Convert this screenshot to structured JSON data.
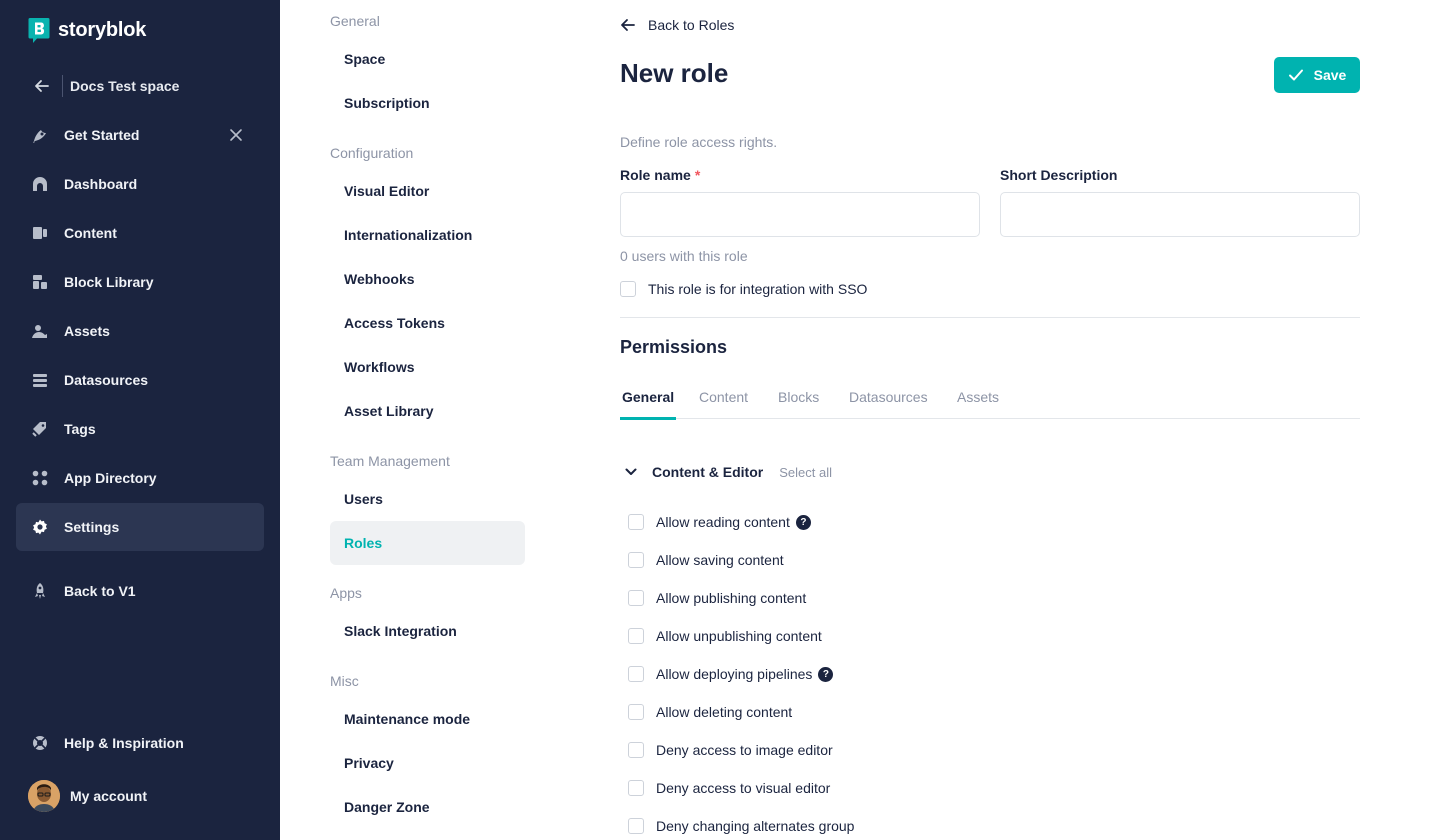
{
  "app": {
    "name": "storyblok"
  },
  "space": {
    "name": "Docs Test space"
  },
  "nav": {
    "items": [
      {
        "label": "Get Started",
        "icon": "rocket-icon"
      },
      {
        "label": "Dashboard",
        "icon": "dashboard-icon"
      },
      {
        "label": "Content",
        "icon": "content-icon"
      },
      {
        "label": "Block Library",
        "icon": "blocks-icon"
      },
      {
        "label": "Assets",
        "icon": "assets-icon"
      },
      {
        "label": "Datasources",
        "icon": "datasources-icon"
      },
      {
        "label": "Tags",
        "icon": "tag-icon"
      },
      {
        "label": "App Directory",
        "icon": "apps-icon"
      },
      {
        "label": "Settings",
        "icon": "gear-icon"
      }
    ],
    "back_v1": "Back to V1",
    "help": "Help & Inspiration",
    "account": "My account"
  },
  "settings_menu": {
    "groups": [
      {
        "title": "General",
        "items": [
          "Space",
          "Subscription"
        ]
      },
      {
        "title": "Configuration",
        "items": [
          "Visual Editor",
          "Internationalization",
          "Webhooks",
          "Access Tokens",
          "Workflows",
          "Asset Library"
        ]
      },
      {
        "title": "Team Management",
        "items": [
          "Users",
          "Roles"
        ]
      },
      {
        "title": "Apps",
        "items": [
          "Slack Integration"
        ]
      },
      {
        "title": "Misc",
        "items": [
          "Maintenance mode",
          "Privacy",
          "Danger Zone"
        ]
      }
    ],
    "active_item": "Roles"
  },
  "main": {
    "back_label": "Back to Roles",
    "title": "New role",
    "save_label": "Save",
    "helper": "Define role access rights.",
    "role_name_label": "Role name",
    "required_mark": "*",
    "short_desc_label": "Short Description",
    "role_name_value": "",
    "short_desc_value": "",
    "users_count": "0 users with this role",
    "sso_label": "This role is for integration with SSO",
    "permissions_title": "Permissions",
    "tabs": [
      "General",
      "Content",
      "Blocks",
      "Datasources",
      "Assets"
    ],
    "active_tab": "General",
    "section_title": "Content & Editor",
    "select_all": "Select all",
    "permissions": [
      {
        "label": "Allow reading content",
        "help": true
      },
      {
        "label": "Allow saving content",
        "help": false
      },
      {
        "label": "Allow publishing content",
        "help": false
      },
      {
        "label": "Allow unpublishing content",
        "help": false
      },
      {
        "label": "Allow deploying pipelines",
        "help": true
      },
      {
        "label": "Allow deleting content",
        "help": false
      },
      {
        "label": "Deny access to image editor",
        "help": false
      },
      {
        "label": "Deny access to visual editor",
        "help": false
      },
      {
        "label": "Deny changing alternates group",
        "help": false
      }
    ],
    "help_glyph": "?"
  },
  "colors": {
    "sidebar": "#1b243f",
    "accent": "#00b3b0",
    "required": "#f1565e",
    "muted": "#8d94a6"
  }
}
